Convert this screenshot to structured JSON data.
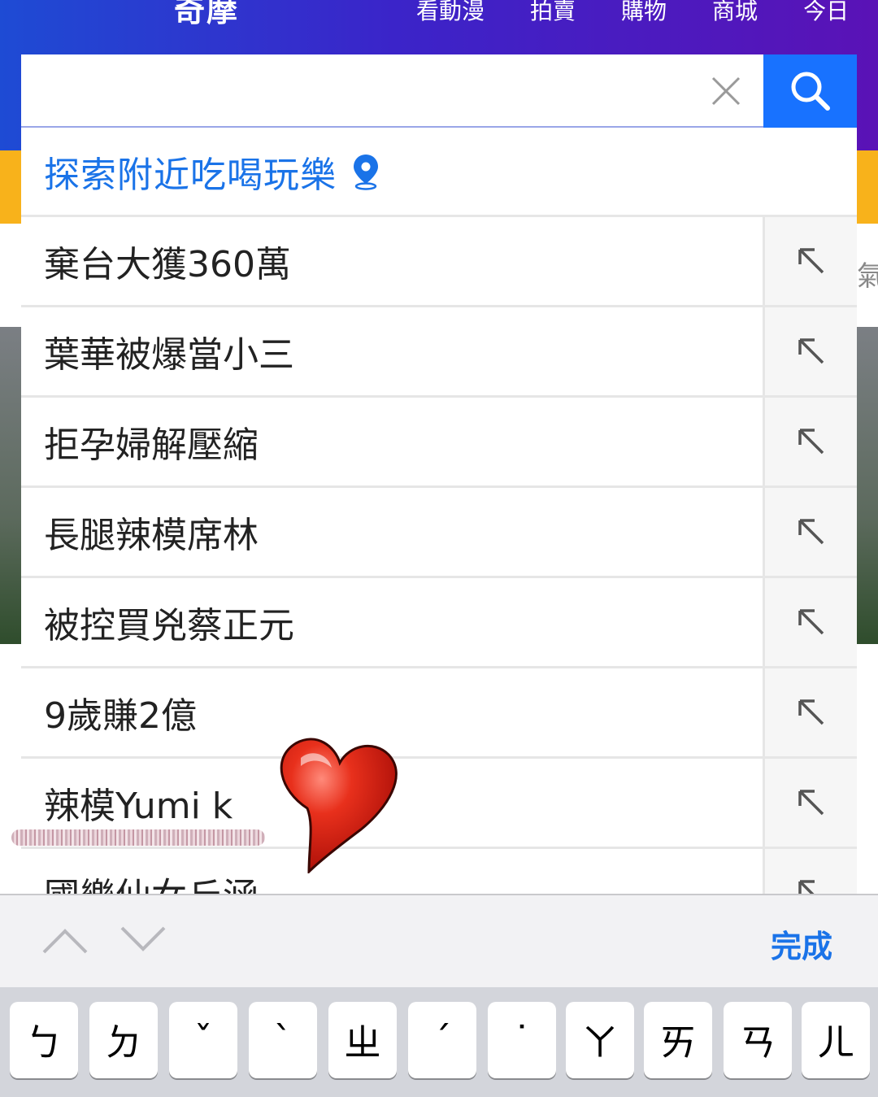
{
  "header": {
    "logo": "奇摩",
    "nav": [
      "看動漫",
      "拍賣",
      "購物",
      "商城",
      "今日"
    ]
  },
  "search": {
    "value": "",
    "placeholder": ""
  },
  "dropdown": {
    "explore": "探索附近吃喝玩樂",
    "suggestions": [
      "棄台大獲360萬",
      "葉華被爆當小三",
      "拒孕婦解壓縮",
      "長腿辣模席林",
      "被控買兇蔡正元",
      "9歲賺2億",
      "辣模Yumi k",
      "國樂仙女丘涵"
    ]
  },
  "background": {
    "peek_text": "氣象"
  },
  "accessory": {
    "done": "完成"
  },
  "keyboard": {
    "keys": [
      "ㄅ",
      "ㄉ",
      "ˇ",
      "ˋ",
      "ㄓ",
      "ˊ",
      "˙",
      "ㄚ",
      "ㄞ",
      "ㄢ",
      "ㄦ"
    ]
  },
  "colors": {
    "header_start": "#1e4bd4",
    "header_end": "#5a12b6",
    "search_button": "#1872ff",
    "link_blue": "#1a73e8",
    "heart_red": "#e02a1a"
  }
}
